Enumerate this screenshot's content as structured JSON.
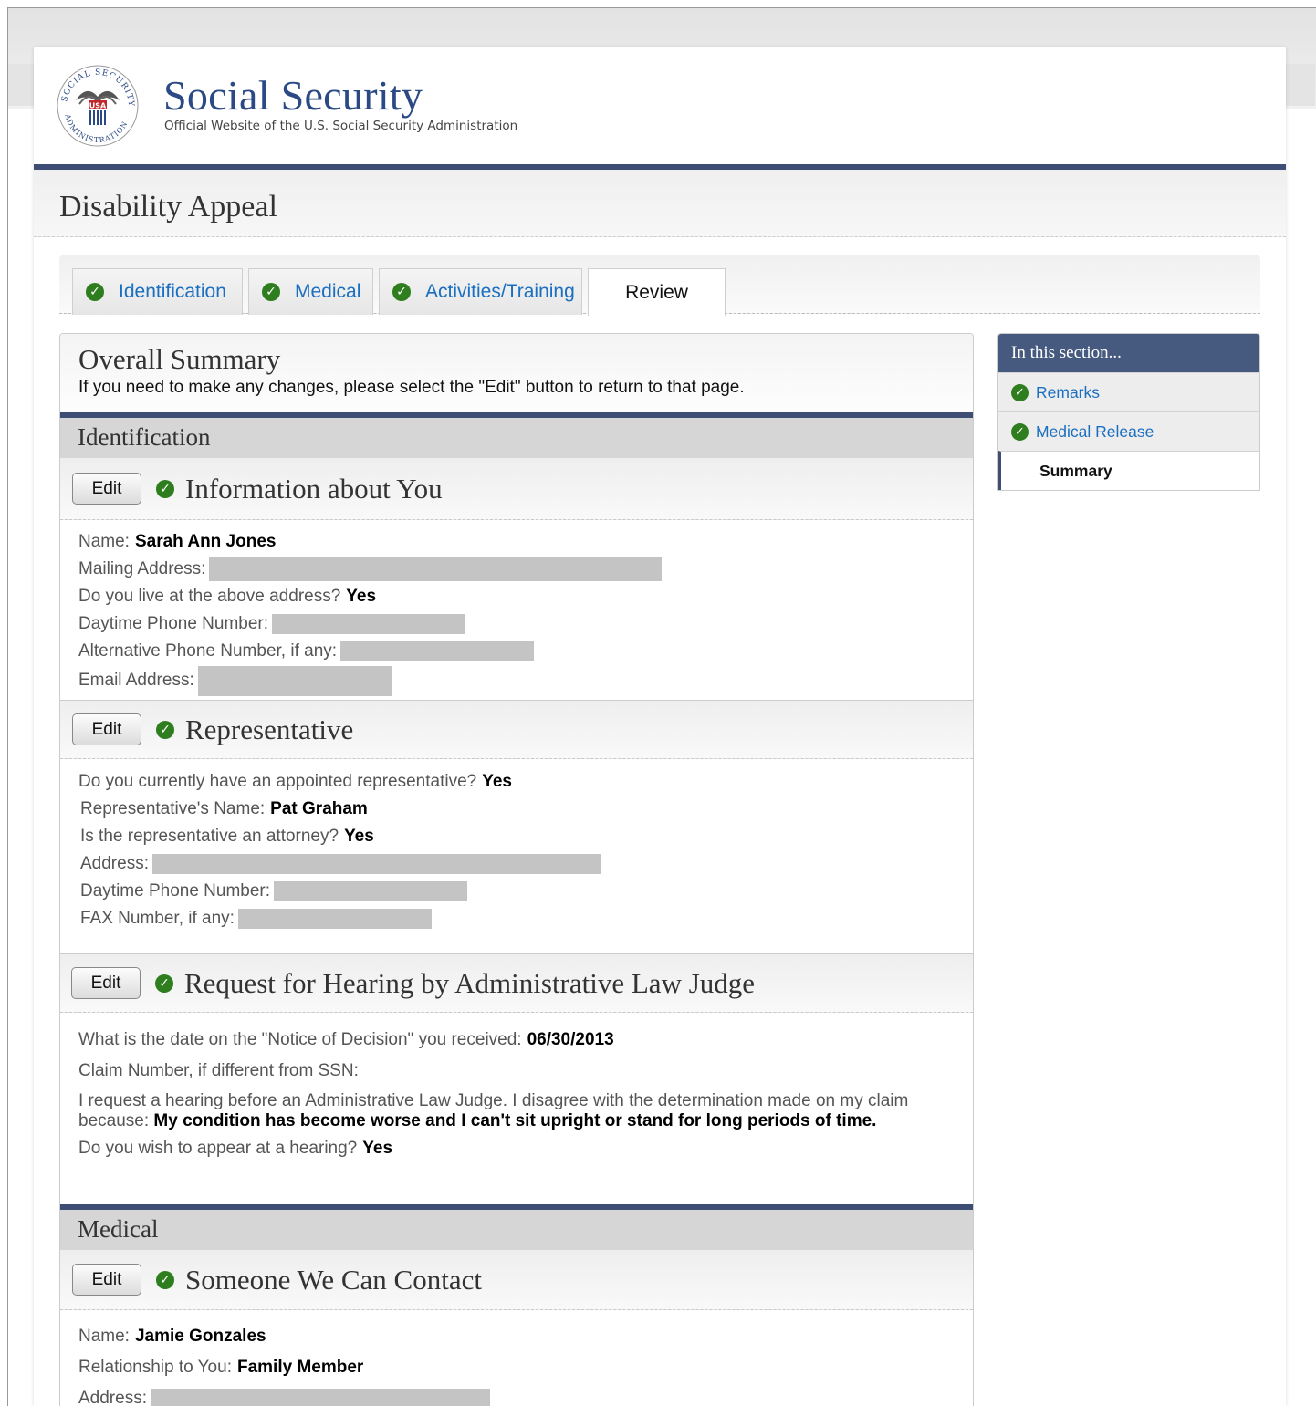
{
  "brand": {
    "title": "Social Security",
    "subtitle": "Official Website of the U.S. Social Security Administration",
    "seal_text_top": "SOCIAL SECURITY",
    "seal_text_bottom": "ADMINISTRATION",
    "seal_usa": "USA"
  },
  "page_title": "Disability Appeal",
  "tabs": [
    {
      "label": "Identification",
      "complete": true
    },
    {
      "label": "Medical",
      "complete": true
    },
    {
      "label": "Activities/Training",
      "complete": true
    },
    {
      "label": "Review",
      "active": true
    }
  ],
  "overall": {
    "title": "Overall Summary",
    "note": "If you need to make any changes, please select the \"Edit\" button to return to that page."
  },
  "edit_label": "Edit",
  "identification": {
    "section_title": "Identification",
    "info": {
      "title": "Information about You",
      "name_label": "Name:",
      "name_value": "Sarah Ann Jones",
      "mailing_label": "Mailing Address:",
      "live_label": "Do you live at the above address?",
      "live_value": "Yes",
      "daytime_label": "Daytime Phone Number:",
      "alt_label": "Alternative Phone Number, if any:",
      "email_label": "Email Address:"
    },
    "rep": {
      "title": "Representative",
      "has_label": "Do you currently have an appointed representative?",
      "has_value": "Yes",
      "name_label": "Representative's Name:",
      "name_value": "Pat Graham",
      "attorney_label": "Is the representative an attorney?",
      "attorney_value": "Yes",
      "address_label": "Address:",
      "daytime_label": "Daytime Phone Number:",
      "fax_label": "FAX Number, if any:"
    },
    "hearing": {
      "title": "Request for Hearing by Administrative Law Judge",
      "date_label": "What is the date on the \"Notice of Decision\" you received:",
      "date_value": "06/30/2013",
      "claim_label": "Claim Number, if different from SSN:",
      "request_label": "I request a hearing before an Administrative Law Judge. I disagree with the determination made on my claim because:",
      "request_value": "My condition has become worse and I can't sit upright or stand for long periods of time.",
      "appear_label": "Do you wish to appear at a hearing?",
      "appear_value": "Yes"
    }
  },
  "medical": {
    "section_title": "Medical",
    "contact": {
      "title": "Someone We Can Contact",
      "name_label": "Name:",
      "name_value": "Jamie Gonzales",
      "rel_label": "Relationship to You:",
      "rel_value": "Family Member",
      "address_label": "Address:"
    }
  },
  "sidebar": {
    "heading": "In this section...",
    "items": [
      {
        "label": "Remarks",
        "complete": true
      },
      {
        "label": "Medical Release",
        "complete": true
      },
      {
        "label": "Summary",
        "current": true
      }
    ]
  },
  "colors": {
    "brand_blue": "#2b4a85",
    "rule_navy": "#3d4d74",
    "check_green": "#2e7d1e",
    "link_blue": "#1a6fc0"
  }
}
